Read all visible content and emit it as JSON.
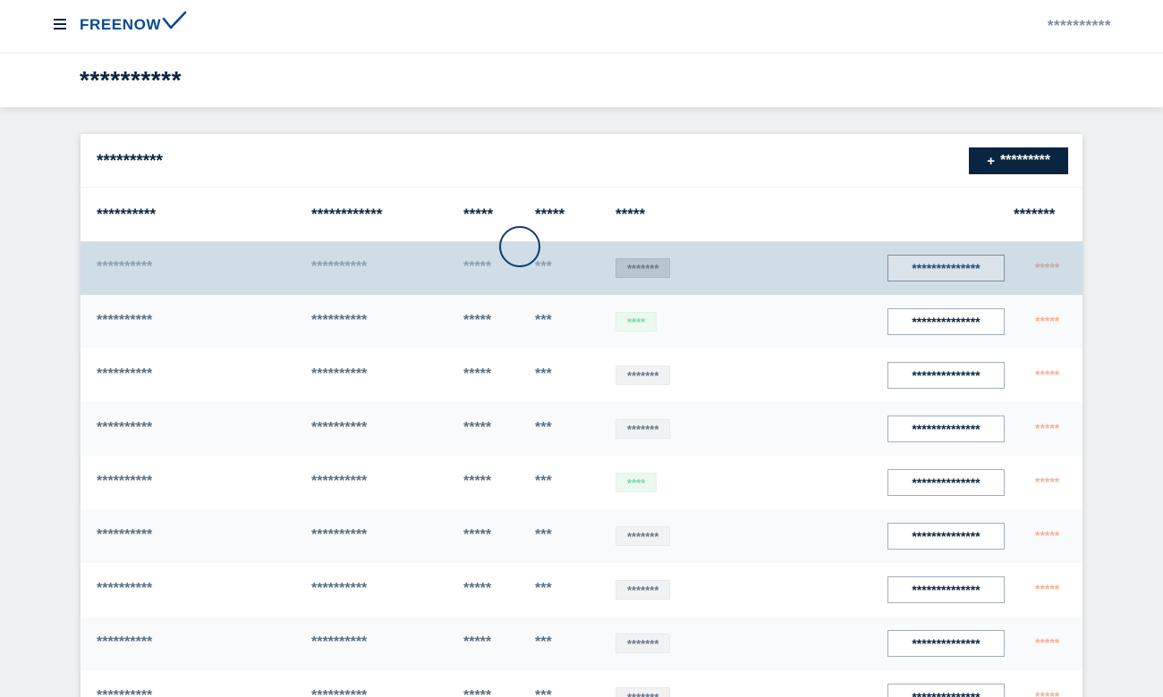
{
  "topbar": {
    "logo_text": "FREENOW",
    "user_name": "**********"
  },
  "page": {
    "title": "**********"
  },
  "card": {
    "title": "**********",
    "add_button_label": "*********",
    "columns": [
      "**********",
      "************",
      "*****",
      "*****",
      "*****",
      "*******"
    ]
  },
  "rows": [
    {
      "c1": "**********",
      "c2": "**********",
      "c3": "*****",
      "c4": "***",
      "badge": "*******",
      "badge_type": "gray",
      "action": "**************",
      "link": "*****"
    },
    {
      "c1": "**********",
      "c2": "**********",
      "c3": "*****",
      "c4": "***",
      "badge": "****",
      "badge_type": "green",
      "action": "**************",
      "link": "*****"
    },
    {
      "c1": "**********",
      "c2": "**********",
      "c3": "*****",
      "c4": "***",
      "badge": "*******",
      "badge_type": "gray",
      "action": "**************",
      "link": "*****"
    },
    {
      "c1": "**********",
      "c2": "**********",
      "c3": "*****",
      "c4": "***",
      "badge": "*******",
      "badge_type": "gray",
      "action": "**************",
      "link": "*****"
    },
    {
      "c1": "**********",
      "c2": "**********",
      "c3": "*****",
      "c4": "***",
      "badge": "****",
      "badge_type": "green",
      "action": "**************",
      "link": "*****"
    },
    {
      "c1": "**********",
      "c2": "**********",
      "c3": "*****",
      "c4": "***",
      "badge": "*******",
      "badge_type": "gray",
      "action": "**************",
      "link": "*****"
    },
    {
      "c1": "**********",
      "c2": "**********",
      "c3": "*****",
      "c4": "***",
      "badge": "*******",
      "badge_type": "gray",
      "action": "**************",
      "link": "*****"
    },
    {
      "c1": "**********",
      "c2": "**********",
      "c3": "*****",
      "c4": "***",
      "badge": "*******",
      "badge_type": "gray",
      "action": "**************",
      "link": "*****"
    },
    {
      "c1": "**********",
      "c2": "**********",
      "c3": "*****",
      "c4": "***",
      "badge": "*******",
      "badge_type": "gray",
      "action": "**************",
      "link": "*****"
    }
  ],
  "colors": {
    "brand_blue": "#0b4a8b",
    "navy": "#0a2540",
    "selected_row": "#cfdde6",
    "link_orange": "#f1b39a",
    "badge_green": "#7fd5a6"
  },
  "icons": {
    "menu": "hamburger-menu-icon",
    "logo_mark": "checkmark-logo-icon",
    "add": "plus-icon"
  }
}
